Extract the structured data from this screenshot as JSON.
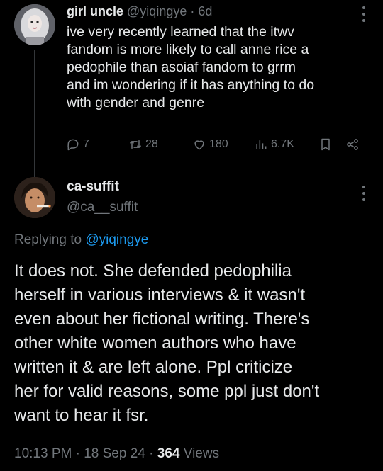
{
  "post1": {
    "display_name": "girl uncle",
    "handle": "@yiqingye",
    "separator": "·",
    "age": "6d",
    "lines": [
      "ive very recently learned that the itwv",
      "fandom is more likely to call anne rice a",
      "pedophile than asoiaf fandom to grrm",
      "and im wondering if it has anything to do",
      "with gender and genre"
    ],
    "actions": {
      "replies": "7",
      "reposts": "28",
      "likes": "180",
      "views": "6.7K"
    },
    "icons": [
      "more-icon",
      "reply-icon",
      "repost-icon",
      "like-icon",
      "views-icon",
      "bookmark-icon",
      "share-icon"
    ]
  },
  "post2": {
    "display_name": "ca-suffit",
    "handle": "@ca__suffit",
    "replying_prefix": "Replying to",
    "replying_to": "@yiqingye",
    "lines": [
      "It does not. She defended pedophilia",
      "herself in various interviews & it wasn't",
      "even about her fictional writing. There's",
      "other white women authors who have",
      "written it & are left alone. Ppl criticize",
      "her for valid reasons, some ppl just don't",
      "want to hear it fsr."
    ],
    "meta": {
      "time": "10:13 PM",
      "dot1": "·",
      "date": "18 Sep 24",
      "dot2": "·",
      "views_count": "364",
      "views_label": "Views"
    }
  },
  "colors": {
    "background": "#000000",
    "text": "#e7e9ea",
    "muted": "#71767b",
    "link": "#1d9bf0"
  }
}
